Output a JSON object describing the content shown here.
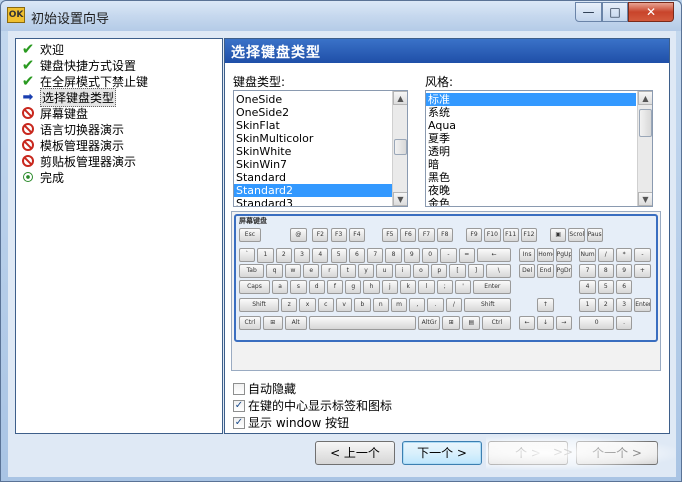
{
  "window": {
    "title": "初始设置向导",
    "app_icon_text": "OK",
    "controls": {
      "minimize": "—",
      "maximize": "□",
      "close": "✕"
    }
  },
  "steps": [
    {
      "label": "欢迎",
      "status": "done",
      "icon": "checkmark-icon"
    },
    {
      "label": "键盘快捷方式设置",
      "status": "done",
      "icon": "checkmark-icon"
    },
    {
      "label": "在全屏模式下禁止键",
      "status": "done",
      "icon": "checkmark-icon"
    },
    {
      "label": "选择键盘类型",
      "status": "current",
      "icon": "arrow-right-icon"
    },
    {
      "label": "屏幕键盘",
      "status": "pending",
      "icon": "no-entry-icon"
    },
    {
      "label": "语言切换器演示",
      "status": "pending",
      "icon": "no-entry-icon"
    },
    {
      "label": "模板管理器演示",
      "status": "pending",
      "icon": "no-entry-icon"
    },
    {
      "label": "剪贴板管理器演示",
      "status": "pending",
      "icon": "no-entry-icon"
    },
    {
      "label": "完成",
      "status": "final",
      "icon": "finish-dot-icon"
    }
  ],
  "panel": {
    "header": "选择键盘类型",
    "keyboard_type_label": "键盘类型:",
    "keyboard_types": [
      "OneSide",
      "OneSide2",
      "SkinFlat",
      "SkinMulticolor",
      "SkinWhite",
      "SkinWin7",
      "Standard",
      "Standard2",
      "Standard3"
    ],
    "keyboard_type_selected": "Standard2",
    "style_label": "风格:",
    "styles": [
      "标准",
      "系统",
      "Aqua",
      "夏季",
      "透明",
      "暗",
      "黑色",
      "夜晚",
      "金色"
    ],
    "style_selected": "标准",
    "preview_title": "屏幕键盘",
    "options": [
      {
        "label": "自动隐藏",
        "checked": false
      },
      {
        "label": "在键的中心显示标签和图标",
        "checked": true
      },
      {
        "label": "显示 window 按钮",
        "checked": true
      }
    ]
  },
  "keyboard_keys": [
    [
      "Esc",
      "@",
      "F2",
      "F3",
      "F4",
      "F5",
      "F6",
      "F7",
      "F8",
      "F9",
      "F10",
      "F11",
      "F12",
      "▣",
      "Scrol",
      "Pause"
    ],
    [
      "`",
      "1",
      "2",
      "3",
      "4",
      "5",
      "6",
      "7",
      "8",
      "9",
      "0",
      "-",
      "=",
      "←",
      "Ins",
      "Home",
      "PgUp",
      "Num",
      "/",
      "*",
      "-"
    ],
    [
      "Tab",
      "q",
      "w",
      "e",
      "r",
      "t",
      "y",
      "u",
      "i",
      "o",
      "p",
      "[",
      "]",
      "\\",
      "Del",
      "End",
      "PgDn",
      "7",
      "8",
      "9",
      "+"
    ],
    [
      "Caps",
      "a",
      "s",
      "d",
      "f",
      "g",
      "h",
      "j",
      "k",
      "l",
      ";",
      "'",
      "Enter",
      "4",
      "5",
      "6"
    ],
    [
      "Shift",
      "z",
      "x",
      "c",
      "v",
      "b",
      "n",
      "m",
      ",",
      ".",
      "/",
      "Shift",
      "↑",
      "1",
      "2",
      "3",
      "Enter"
    ],
    [
      "Ctrl",
      "⊞",
      "Alt",
      "",
      "AltGr",
      "⊞",
      "▤",
      "Ctrl",
      "←",
      "↓",
      "→",
      "0",
      "."
    ]
  ],
  "buttons": {
    "back": "< 上一个",
    "next": "下一个 >",
    "partial_next": "个 >",
    "skip": ">>",
    "last": "个一个 >"
  }
}
